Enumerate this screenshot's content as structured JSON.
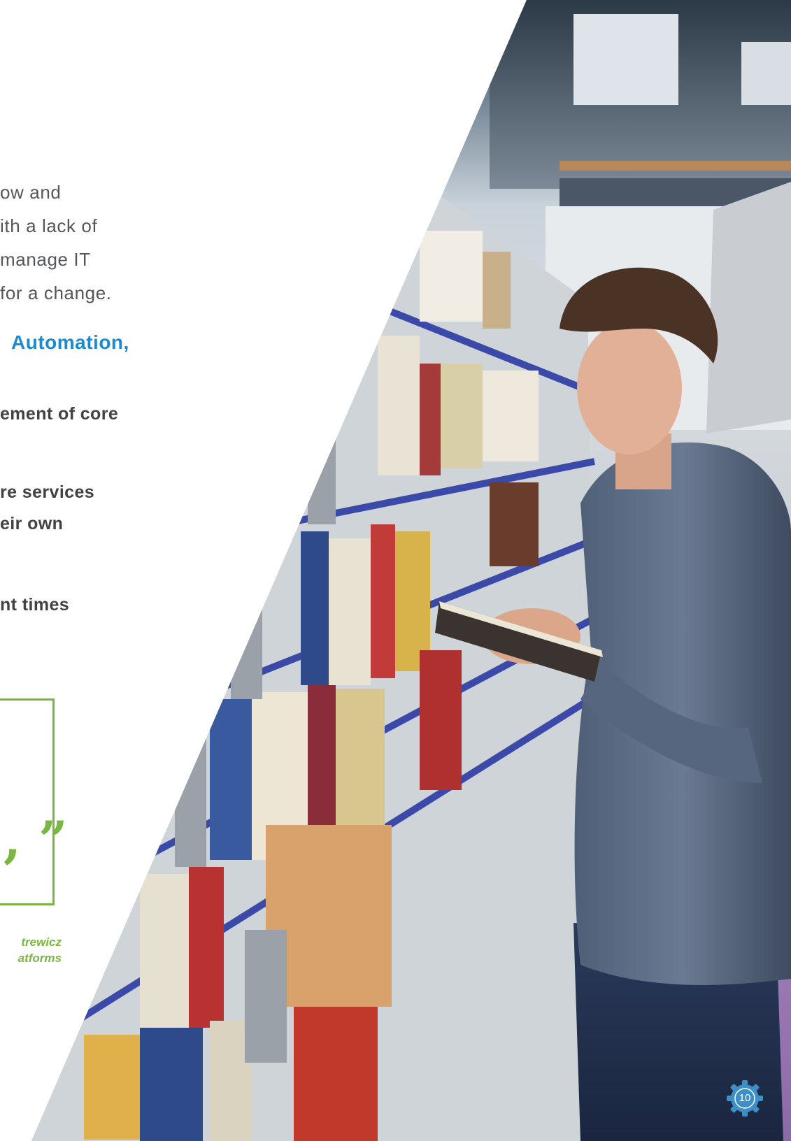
{
  "body_lines": [
    "ow and",
    "ith a lack of",
    "manage IT",
    "for a change."
  ],
  "heading": "Automation,",
  "bullets": [
    "ement of core",
    "re services",
    "eir own",
    "nt times"
  ],
  "quote": {
    "mark": ", ”",
    "attribution_name": "trewicz",
    "attribution_title": "atforms"
  },
  "page_number": "10",
  "colors": {
    "heading_blue": "#1a8bd0",
    "quote_green": "#7ab642",
    "body_gray": "#55565a",
    "badge_blue": "#3d8fc8"
  },
  "icons": {
    "page_badge": "gear-icon"
  }
}
